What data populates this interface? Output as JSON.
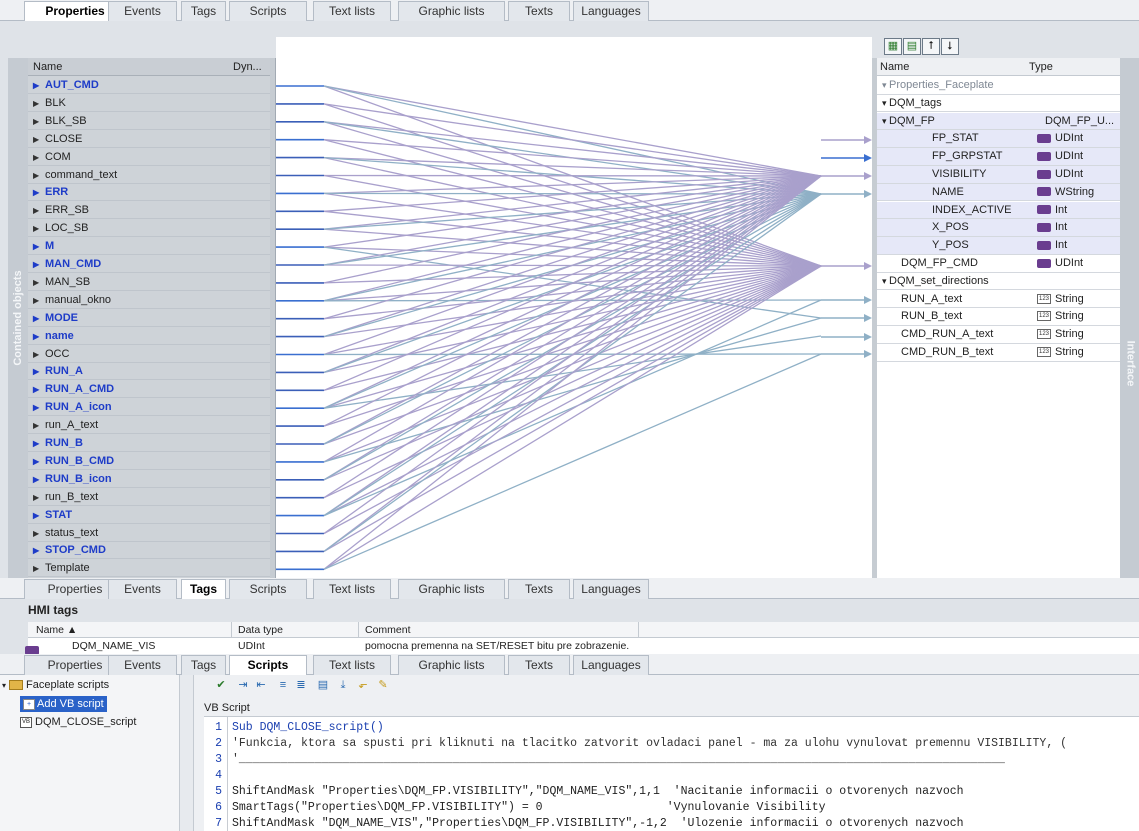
{
  "top_tabs": [
    {
      "label": "Properties",
      "active": true
    },
    {
      "label": "Events"
    },
    {
      "label": "Tags"
    },
    {
      "label": "Scripts"
    },
    {
      "label": "Text lists"
    },
    {
      "label": "Graphic lists"
    },
    {
      "label": "Texts"
    },
    {
      "label": "Languages"
    }
  ],
  "mid_tabs": [
    {
      "label": "Properties"
    },
    {
      "label": "Events"
    },
    {
      "label": "Tags",
      "active": true
    },
    {
      "label": "Scripts"
    },
    {
      "label": "Text lists"
    },
    {
      "label": "Graphic lists"
    },
    {
      "label": "Texts"
    },
    {
      "label": "Languages"
    }
  ],
  "bottom_tabs": [
    {
      "label": "Properties"
    },
    {
      "label": "Events"
    },
    {
      "label": "Tags"
    },
    {
      "label": "Scripts",
      "active": true
    },
    {
      "label": "Text lists"
    },
    {
      "label": "Graphic lists"
    },
    {
      "label": "Texts"
    },
    {
      "label": "Languages"
    }
  ],
  "left_panel": {
    "side_label": "Contained objects",
    "col_name": "Name",
    "col_dyn": "Dyn...",
    "items": [
      {
        "label": "AUT_CMD",
        "bold": true
      },
      {
        "label": "BLK"
      },
      {
        "label": "BLK_SB"
      },
      {
        "label": "CLOSE"
      },
      {
        "label": "COM"
      },
      {
        "label": "command_text"
      },
      {
        "label": "ERR",
        "bold": true
      },
      {
        "label": "ERR_SB"
      },
      {
        "label": "LOC_SB"
      },
      {
        "label": "M",
        "bold": true
      },
      {
        "label": "MAN_CMD",
        "bold": true
      },
      {
        "label": "MAN_SB"
      },
      {
        "label": "manual_okno"
      },
      {
        "label": "MODE",
        "bold": true
      },
      {
        "label": "name",
        "bold": true
      },
      {
        "label": "OCC"
      },
      {
        "label": "RUN_A",
        "bold": true
      },
      {
        "label": "RUN_A_CMD",
        "bold": true
      },
      {
        "label": "RUN_A_icon",
        "bold": true
      },
      {
        "label": "run_A_text"
      },
      {
        "label": "RUN_B",
        "bold": true
      },
      {
        "label": "RUN_B_CMD",
        "bold": true
      },
      {
        "label": "RUN_B_icon",
        "bold": true
      },
      {
        "label": "run_B_text"
      },
      {
        "label": "STAT",
        "bold": true
      },
      {
        "label": "status_text"
      },
      {
        "label": "STOP_CMD",
        "bold": true
      },
      {
        "label": "Template"
      }
    ]
  },
  "right_panel": {
    "side_label": "Interface",
    "col_name": "Name",
    "col_type": "Type",
    "toolbar_icons": [
      "add-icon",
      "add-struct-icon",
      "move-up-icon",
      "move-down-icon"
    ],
    "rows": [
      {
        "name": "Properties_Faceplate",
        "indent": 0,
        "arrow": "▾",
        "dim": true,
        "type": ""
      },
      {
        "name": "DQM_tags",
        "indent": 0,
        "arrow": "▾",
        "type": ""
      },
      {
        "name": "DQM_FP",
        "indent": 1,
        "arrow": "▾",
        "type": "DQM_FP_U...",
        "hl": true
      },
      {
        "name": "FP_STAT",
        "indent": 3,
        "type": "UDInt",
        "icon": "tag",
        "hl": true
      },
      {
        "name": "FP_GRPSTAT",
        "indent": 3,
        "type": "UDInt",
        "icon": "tag",
        "hl": true
      },
      {
        "name": "VISIBILITY",
        "indent": 3,
        "type": "UDInt",
        "icon": "tag",
        "hl": true
      },
      {
        "name": "NAME",
        "indent": 3,
        "type": "WString",
        "icon": "tag",
        "hl": true
      },
      {
        "name": "INDEX_ACTIVE",
        "indent": 3,
        "type": "Int",
        "icon": "tag",
        "hl": true
      },
      {
        "name": "X_POS",
        "indent": 3,
        "type": "Int",
        "icon": "tag",
        "hl": true
      },
      {
        "name": "Y_POS",
        "indent": 3,
        "type": "Int",
        "icon": "tag",
        "hl": true
      },
      {
        "name": "DQM_FP_CMD",
        "indent": 2,
        "type": "UDInt",
        "icon": "tag"
      },
      {
        "name": "DQM_set_directions",
        "indent": 0,
        "arrow": "▾",
        "type": ""
      },
      {
        "name": "RUN_A_text",
        "indent": 2,
        "type": "String",
        "icon": "str"
      },
      {
        "name": "RUN_B_text",
        "indent": 2,
        "type": "String",
        "icon": "str"
      },
      {
        "name": "CMD_RUN_A_text",
        "indent": 2,
        "type": "String",
        "icon": "str"
      },
      {
        "name": "CMD_RUN_B_text",
        "indent": 2,
        "type": "String",
        "icon": "str"
      }
    ]
  },
  "hmi_tags": {
    "title": "HMI tags",
    "col_name": "Name ▲",
    "col_type": "Data type",
    "col_comment": "Comment",
    "rows": [
      {
        "name": "DQM_NAME_VIS",
        "type": "UDInt",
        "comment": "pomocna premenna na SET/RESET bitu pre zobrazenie."
      }
    ]
  },
  "scripts": {
    "tree": {
      "root": "Faceplate scripts",
      "add": "Add VB script",
      "items": [
        "DQM_CLOSE_script"
      ]
    },
    "editor_title": "VB Script",
    "toolbar_icons": [
      "check-icon",
      "indent-icon",
      "outdent-icon",
      "comment-icon",
      "uncomment-icon",
      "bookmark-icon",
      "bookmark-next-icon",
      "bookmark-prev-icon",
      "bookmark-clear-icon"
    ],
    "lines": [
      "Sub DQM_CLOSE_script()",
      "'Funkcia, ktora sa spusti pri kliknuti na tlacitko zatvorit ovladaci panel - ma za ulohu vynulovat premennu VISIBILITY, (",
      "'_______________________________________________________________________________________________________________",
      "",
      "ShiftAndMask \"Properties\\DQM_FP.VISIBILITY\",\"DQM_NAME_VIS\",1,1  'Nacitanie informacii o otvorenych nazvoch",
      "SmartTags(\"Properties\\DQM_FP.VISIBILITY\") = 0                  'Vynulovanie Visibility",
      "ShiftAndMask \"DQM_NAME_VIS\",\"Properties\\DQM_FP.VISIBILITY\",-1,2  'Ulozenie informacii o otvorenych nazvoch"
    ]
  },
  "colors": {
    "accent_blue": "#1e3cc8",
    "tag_icon": "#6a3d8f",
    "line_lavender": "#a9a0cc",
    "line_steel": "#8fb0c6"
  }
}
